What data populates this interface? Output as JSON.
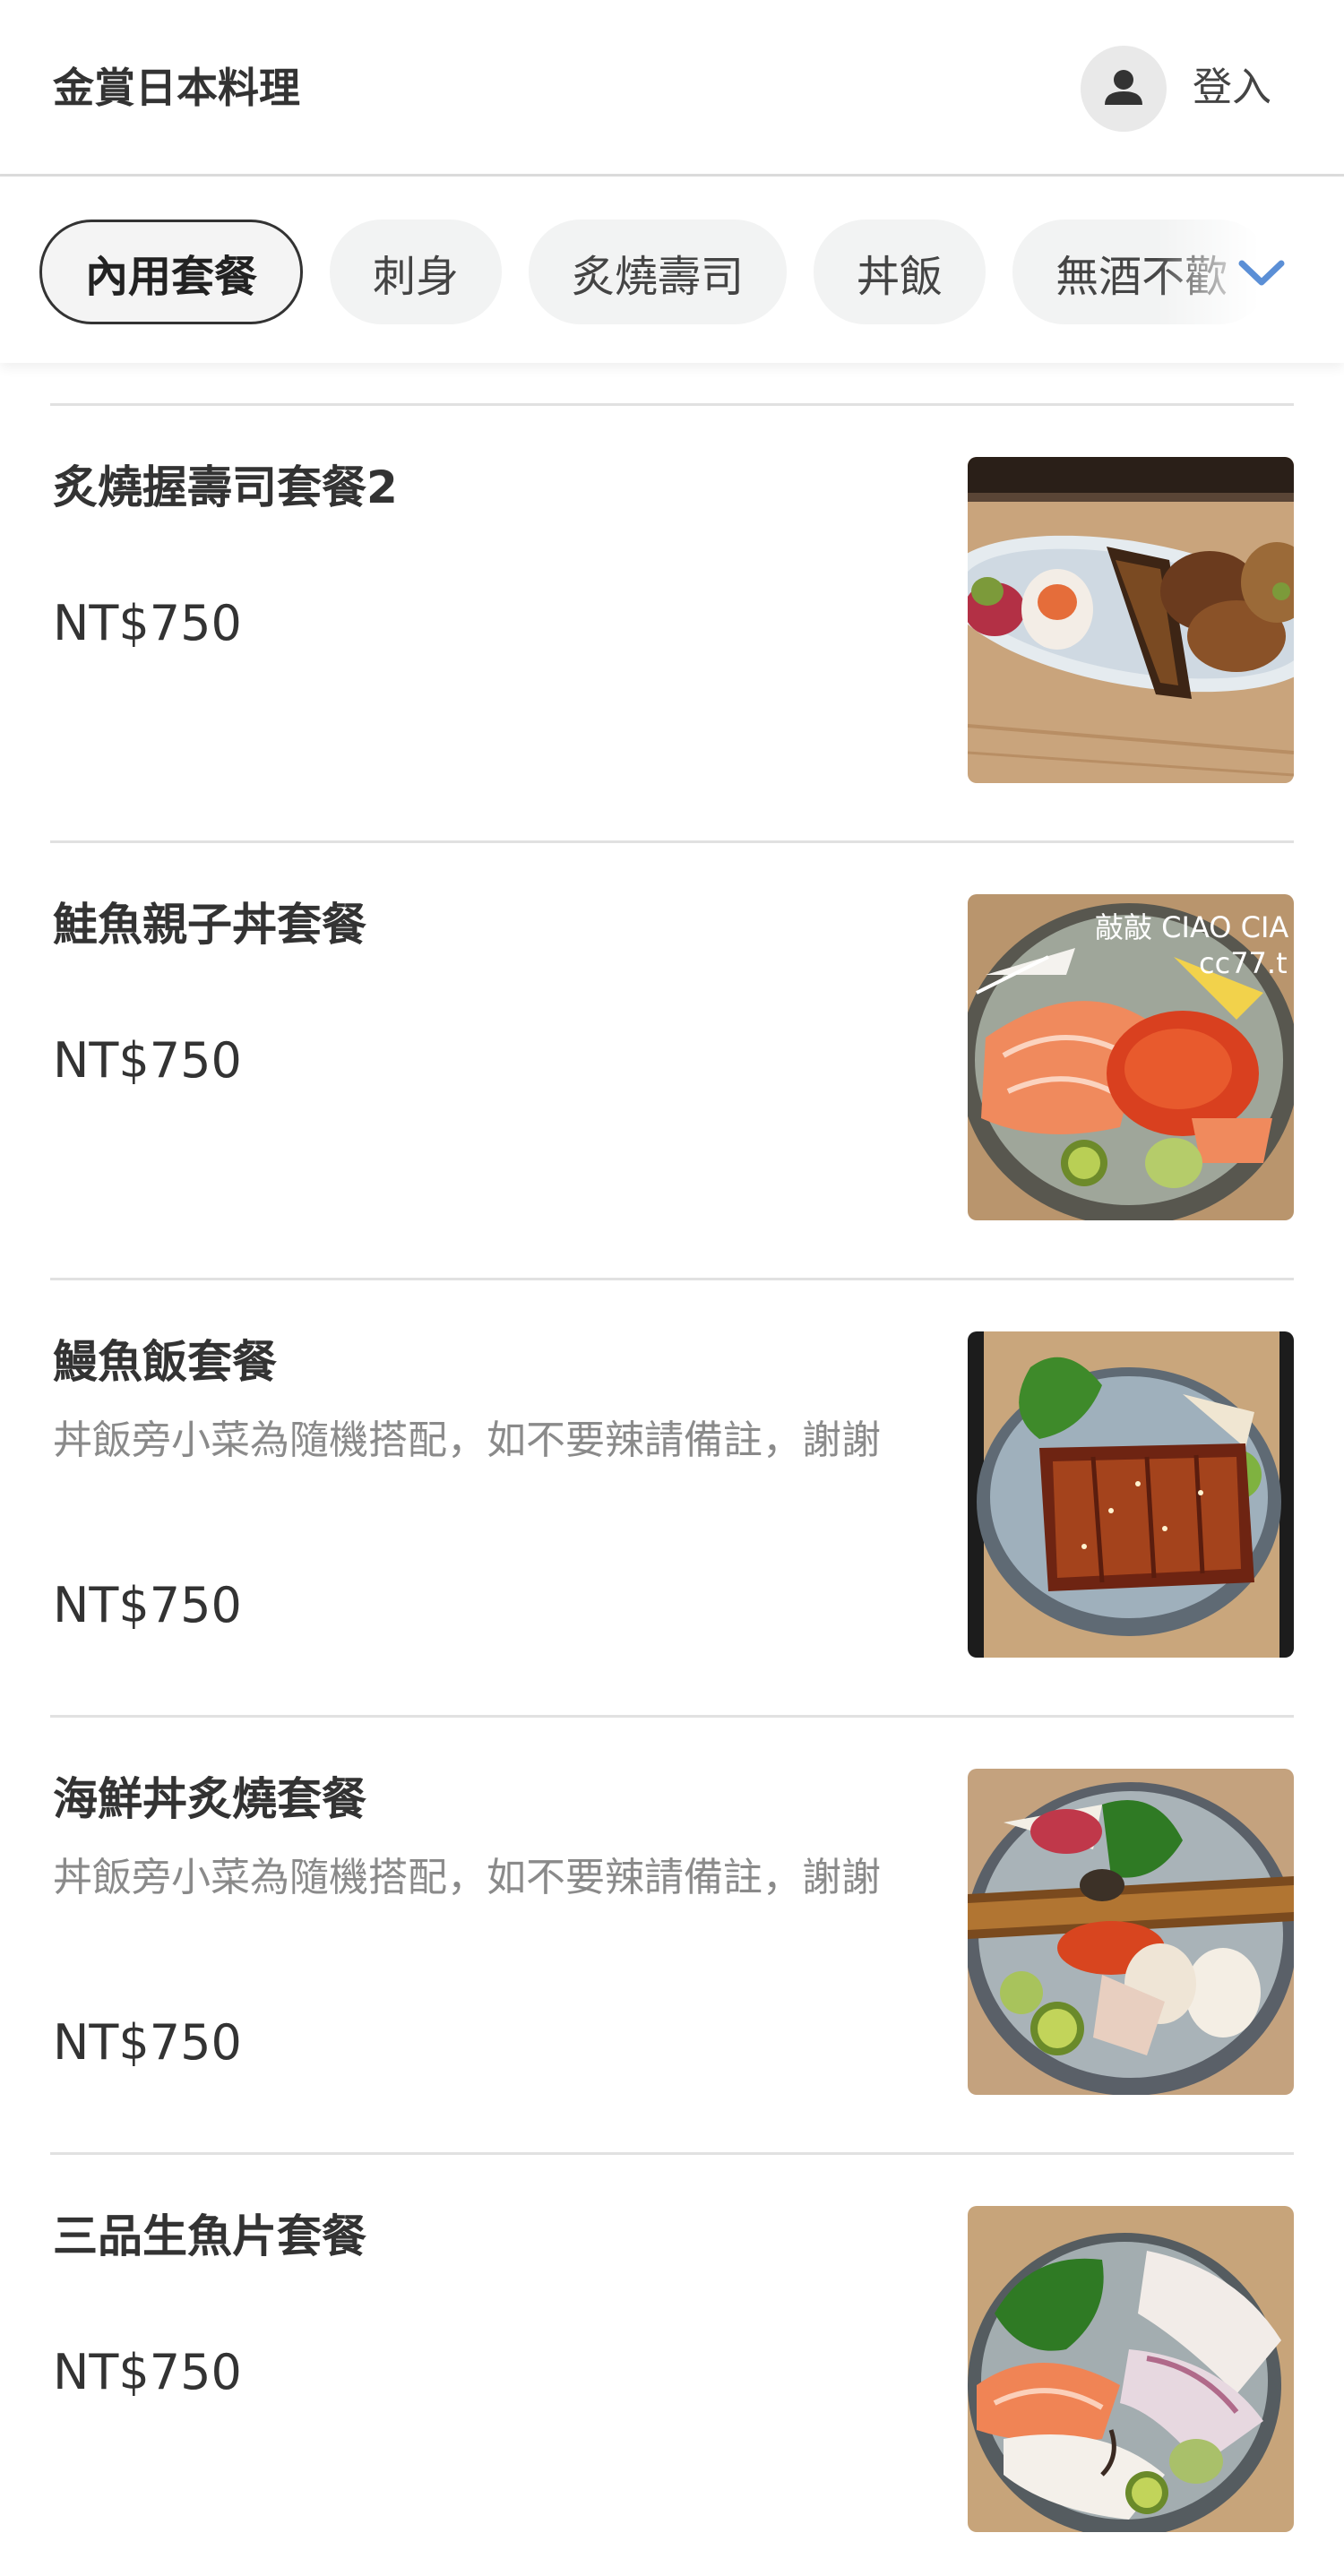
{
  "header": {
    "store_name": "金賞日本料理",
    "login_label": "登入"
  },
  "categories": {
    "tabs": [
      {
        "label": "內用套餐",
        "active": true
      },
      {
        "label": "刺身",
        "active": false
      },
      {
        "label": "炙燒壽司",
        "active": false
      },
      {
        "label": "丼飯",
        "active": false
      },
      {
        "label": "無酒不歡",
        "active": false
      }
    ],
    "more_icon": "chevron-down-icon"
  },
  "menu": {
    "items": [
      {
        "name": "炙燒握壽司套餐2",
        "description": "",
        "price": "NT$750",
        "image": "seared-sushi-platter"
      },
      {
        "name": "鮭魚親子丼套餐",
        "description": "",
        "price": "NT$750",
        "image": "salmon-roe-bowl",
        "watermark_line1": "敲敲 CIAO CIA",
        "watermark_line2": "cc77.t"
      },
      {
        "name": "鰻魚飯套餐",
        "description": "丼飯旁小菜為隨機搭配，如不要辣請備註，謝謝",
        "price": "NT$750",
        "image": "eel-rice-bowl"
      },
      {
        "name": "海鮮丼炙燒套餐",
        "description": "丼飯旁小菜為隨機搭配，如不要辣請備註，謝謝",
        "price": "NT$750",
        "image": "seafood-bowl"
      },
      {
        "name": "三品生魚片套餐",
        "description": "",
        "price": "NT$750",
        "image": "sashimi-bowl"
      }
    ]
  },
  "colors": {
    "text": "#333333",
    "muted": "#8a8a8a",
    "divider": "#e1e1e1",
    "chevron": "#5b8fd6"
  }
}
